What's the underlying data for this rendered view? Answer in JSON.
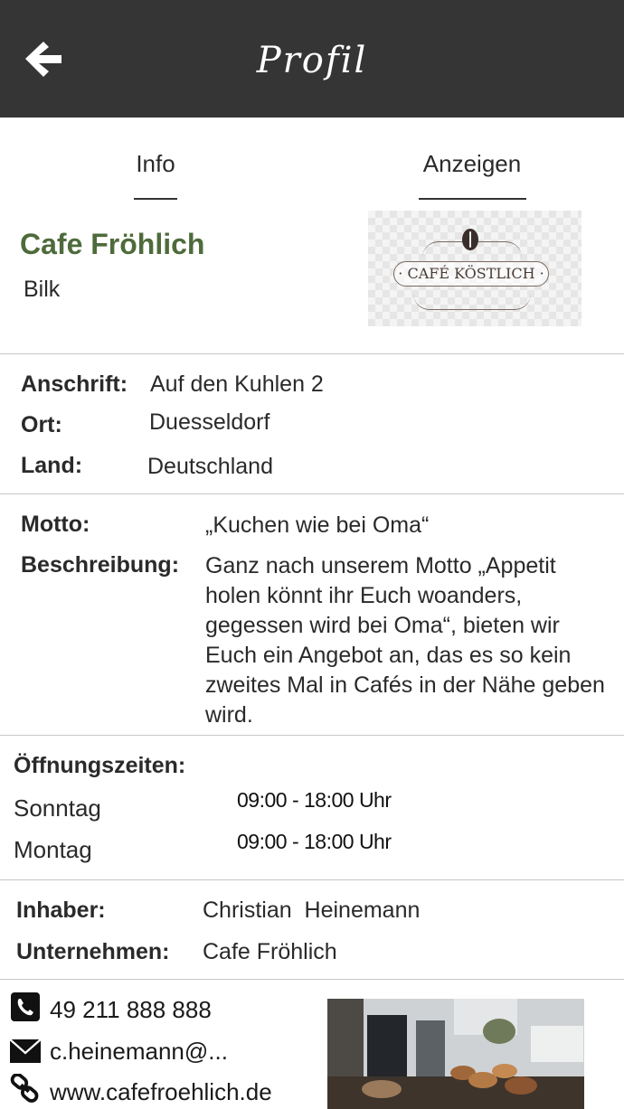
{
  "header": {
    "title": "Profil",
    "back_icon": "arrow-left-icon"
  },
  "tabs": [
    {
      "label": "Info"
    },
    {
      "label": "Anzeigen"
    }
  ],
  "cafe": {
    "name": "Cafe Fröhlich",
    "district": "Bilk",
    "logo_text": "· CAFÉ KÖSTLICH ·"
  },
  "address": {
    "street_label": "Anschrift:",
    "street": "Auf den Kuhlen 2",
    "city_label": "Ort:",
    "city": "Duesseldorf",
    "country_label": "Land:",
    "country": "Deutschland"
  },
  "about": {
    "motto_label": "Motto:",
    "motto": "„Kuchen wie bei Oma“",
    "description_label": "Beschreibung:",
    "description": "Ganz nach unserem Motto „Appetit holen könnt ihr Euch woanders, gegessen wird bei Oma“, bieten wir Euch ein Angebot an, das es so kein zweites Mal in Cafés in der Nähe geben wird."
  },
  "opening_hours": {
    "title": "Öffnungszeiten:",
    "days": [
      {
        "day": "Sonntag",
        "hours": "09:00 - 18:00 Uhr"
      },
      {
        "day": "Montag",
        "hours": "09:00 - 18:00 Uhr"
      }
    ]
  },
  "owner": {
    "owner_label": "Inhaber:",
    "owner": "Christian  Heinemann",
    "company_label": "Unternehmen:",
    "company": "Cafe Fröhlich"
  },
  "contact": {
    "phone": "49 211 888 888",
    "email": "c.heinemann@...",
    "website": "www.cafefroehlich.de"
  },
  "colors": {
    "header_bg": "#353535",
    "cafe_name": "#4e6b3b"
  }
}
